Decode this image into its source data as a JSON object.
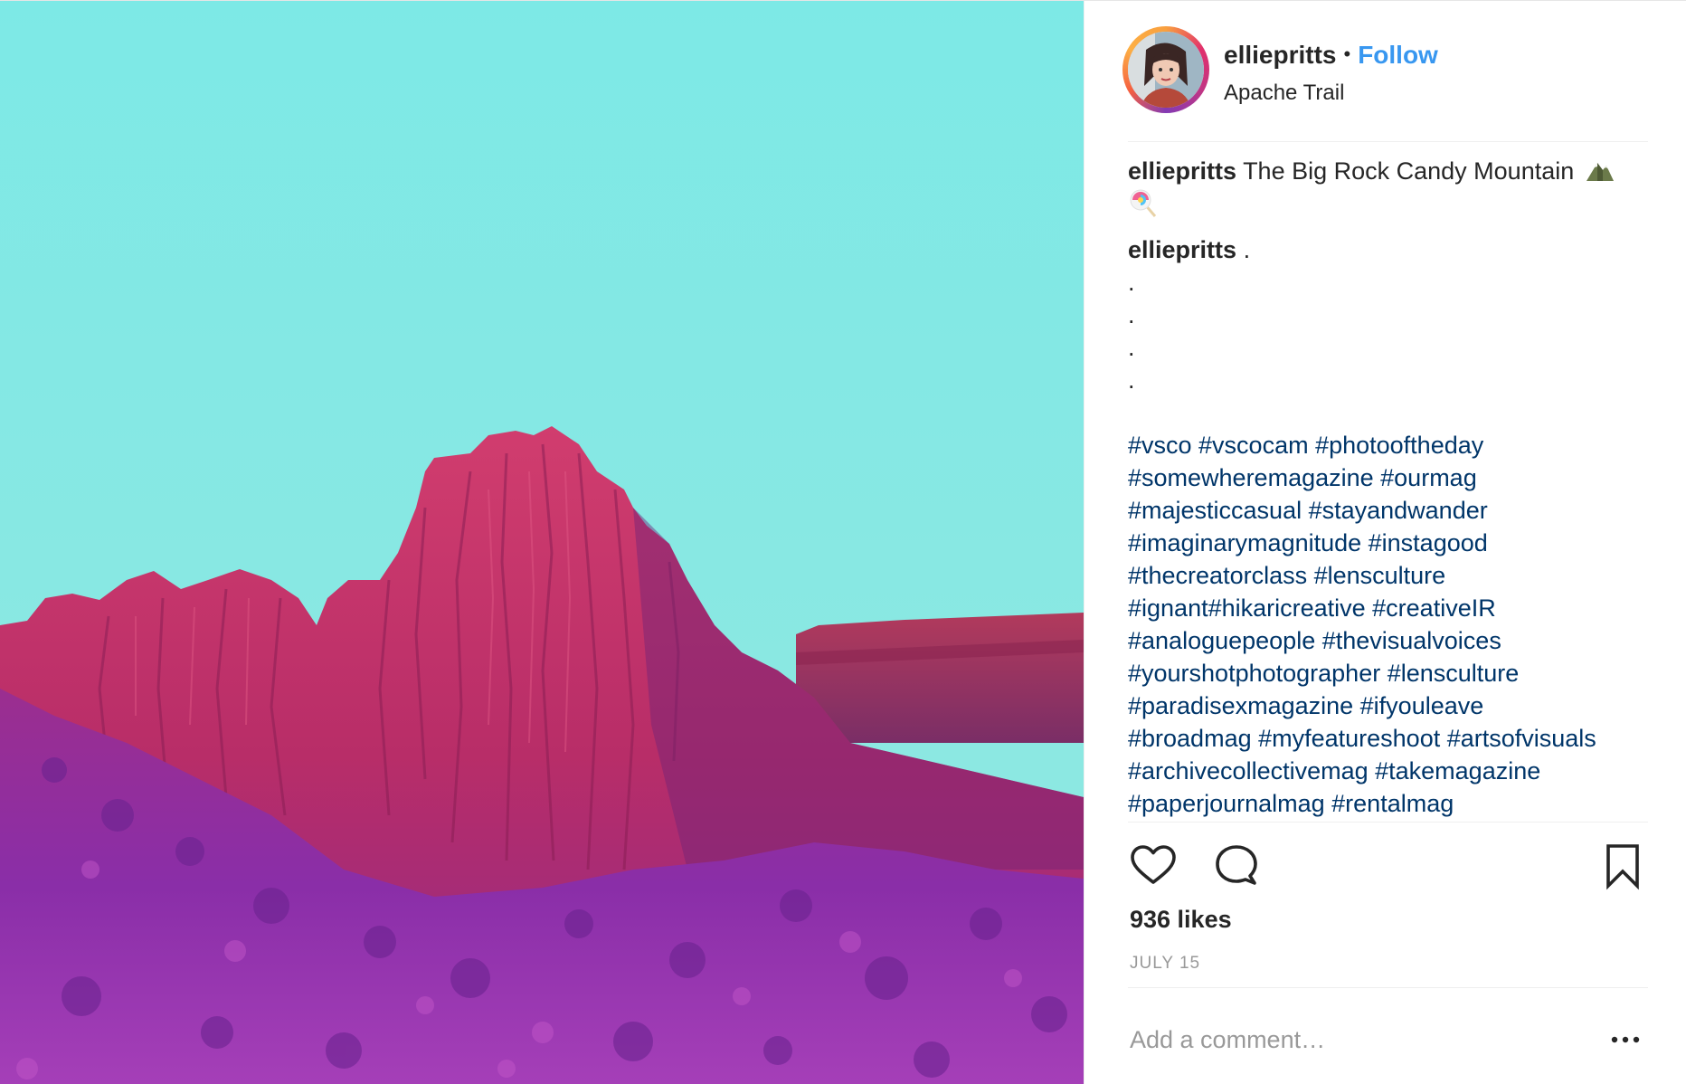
{
  "post": {
    "username": "elliepritts",
    "separator": "•",
    "follow_label": "Follow",
    "location": "Apache Trail"
  },
  "caption": {
    "username": "elliepritts",
    "text": "The Big Rock Candy Mountain",
    "emojis": [
      "mountain-emoji",
      "lollipop-emoji"
    ]
  },
  "comment": {
    "username": "elliepritts",
    "text": ".",
    "dots": [
      ".",
      ".",
      ".",
      "."
    ],
    "hashtags": [
      "#vsco #vscocam #photooftheday",
      "#somewheremagazine #ourmag",
      "#majesticcasual #stayandwander",
      "#imaginarymagnitude #instagood",
      "#thecreatorclass #lensculture",
      "#ignant#hikaricreative #creativeIR",
      "#analoguepeople #thevisualvoices",
      "#yourshotphotographer #lensculture",
      "#paradisexmagazine #ifyouleave",
      "#broadmag #myfeatureshoot #artsofvisuals",
      "#archivecollectivemag #takemagazine",
      "#paperjournalmag #rentalmag"
    ]
  },
  "actions": {
    "icons": [
      "heart-icon",
      "comment-icon",
      "bookmark-icon"
    ]
  },
  "likes": "936 likes",
  "date": "JULY 15",
  "add_comment": {
    "placeholder": "Add a comment…",
    "more_icon": "more-options-icon"
  },
  "colors": {
    "sky": "#7de9e6",
    "rock": "#c0306a",
    "ground": "#8a2fa8",
    "follow": "#3897f0",
    "hashtag": "#003569",
    "muted": "#999999"
  }
}
